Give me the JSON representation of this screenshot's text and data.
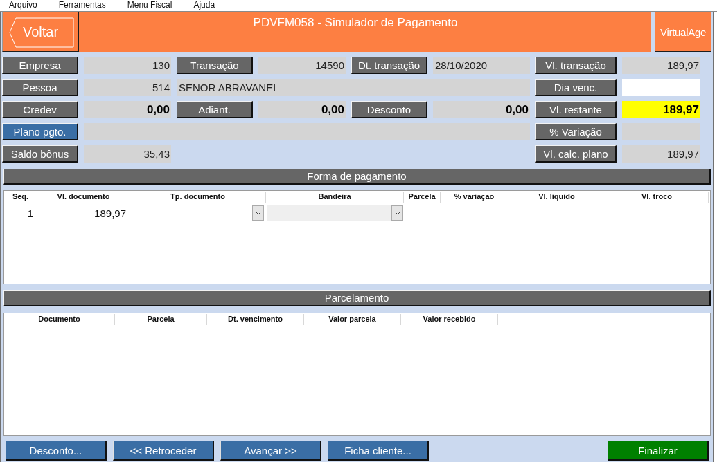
{
  "menu": [
    {
      "label": "Arquivo"
    },
    {
      "label": "Ferramentas"
    },
    {
      "label": "Menu Fiscal"
    },
    {
      "label": "Ajuda"
    }
  ],
  "header": {
    "back_button": "Voltar",
    "title": "PDVFM058 - Simulador de Pagamento",
    "logo": "VirtualAge"
  },
  "form": {
    "rows": [
      {
        "left": [
          {
            "kind": "label",
            "text": "Empresa"
          },
          {
            "kind": "number",
            "text": "130",
            "editable": false,
            "highlighted": false,
            "emphasis": false,
            "wide": false
          },
          {
            "kind": "label",
            "text": "Transação"
          },
          {
            "kind": "number",
            "text": "14590",
            "editable": false,
            "highlighted": false,
            "emphasis": false,
            "wide": false
          },
          {
            "kind": "label",
            "text": "Dt. transação"
          },
          {
            "kind": "text",
            "text": "28/10/2020",
            "editable": false,
            "highlighted": false,
            "emphasis": false,
            "wide": false
          }
        ],
        "right": [
          {
            "kind": "label",
            "text": "Vl. transação"
          },
          {
            "kind": "number",
            "text": "189,97",
            "editable": false,
            "highlighted": false,
            "emphasis": false
          }
        ]
      },
      {
        "left": [
          {
            "kind": "label",
            "text": "Pessoa"
          },
          {
            "kind": "number",
            "text": "514",
            "editable": false,
            "highlighted": false,
            "emphasis": false,
            "wide": false
          },
          {
            "kind": "text",
            "text": "SENOR ABRAVANEL",
            "editable": false,
            "highlighted": false,
            "emphasis": false,
            "wide": true
          }
        ],
        "right": [
          {
            "kind": "label",
            "text": "Dia venc."
          },
          {
            "kind": "text",
            "editable": true,
            "highlighted": false
          }
        ]
      },
      {
        "left": [
          {
            "kind": "label",
            "text": "Credev"
          },
          {
            "kind": "number",
            "text": "0,00",
            "editable": false,
            "highlighted": false,
            "emphasis": true,
            "wide": false
          },
          {
            "kind": "label",
            "text": "Adiant."
          },
          {
            "kind": "number",
            "text": "0,00",
            "editable": false,
            "highlighted": false,
            "emphasis": true,
            "wide": false
          },
          {
            "kind": "label",
            "text": "Desconto"
          },
          {
            "kind": "number",
            "text": "0,00",
            "editable": false,
            "highlighted": false,
            "emphasis": true,
            "wide": false
          }
        ],
        "right": [
          {
            "kind": "label",
            "text": "Vl. restante"
          },
          {
            "kind": "number",
            "text": "189,97",
            "highlighted": true,
            "emphasis": true
          }
        ]
      },
      {
        "left": [
          {
            "kind": "lookup",
            "text": "Plano pgto."
          },
          {
            "kind": "text",
            "editable": false,
            "highlighted": false,
            "wide": true
          }
        ],
        "right": [
          {
            "kind": "label",
            "text": "% Variação"
          },
          {
            "kind": "number",
            "editable": false,
            "highlighted": false
          }
        ]
      },
      {
        "left": [
          {
            "kind": "label",
            "text": "Saldo bônus"
          },
          {
            "kind": "number",
            "text": "35,43",
            "editable": false,
            "highlighted": false,
            "emphasis": false,
            "wide": false
          }
        ],
        "right": [
          {
            "kind": "label",
            "text": "Vl. calc. plano"
          },
          {
            "kind": "number",
            "text": "189,97",
            "editable": false,
            "highlighted": false,
            "emphasis": false
          }
        ]
      }
    ]
  },
  "payment_section": {
    "title": "Forma de pagamento",
    "columns": [
      "Seq.",
      "Vl. documento",
      "Tp. documento",
      "Bandeira",
      "Parcela",
      "% variação",
      "Vl. liquido",
      "Vl. troco"
    ],
    "rows": [
      {
        "cells": [
          {
            "kind": "number",
            "text": "1"
          },
          {
            "kind": "number",
            "text": "189,97"
          },
          {
            "kind": "combo",
            "disabled": false
          },
          {
            "kind": "combo",
            "disabled": true
          }
        ]
      }
    ]
  },
  "installments_section": {
    "title": "Parcelamento",
    "columns": [
      "Documento",
      "Parcela",
      "Dt. vencimento",
      "Valor parcela",
      "Valor recebido"
    ]
  },
  "footer_buttons": [
    {
      "label": "Desconto...",
      "kind": "nav"
    },
    {
      "label": "<< Retroceder",
      "kind": "nav"
    },
    {
      "label": "Avançar >>",
      "kind": "nav"
    },
    {
      "label": "Ficha cliente...",
      "kind": "nav"
    },
    {
      "label": "Finalizar",
      "kind": "confirm"
    }
  ]
}
